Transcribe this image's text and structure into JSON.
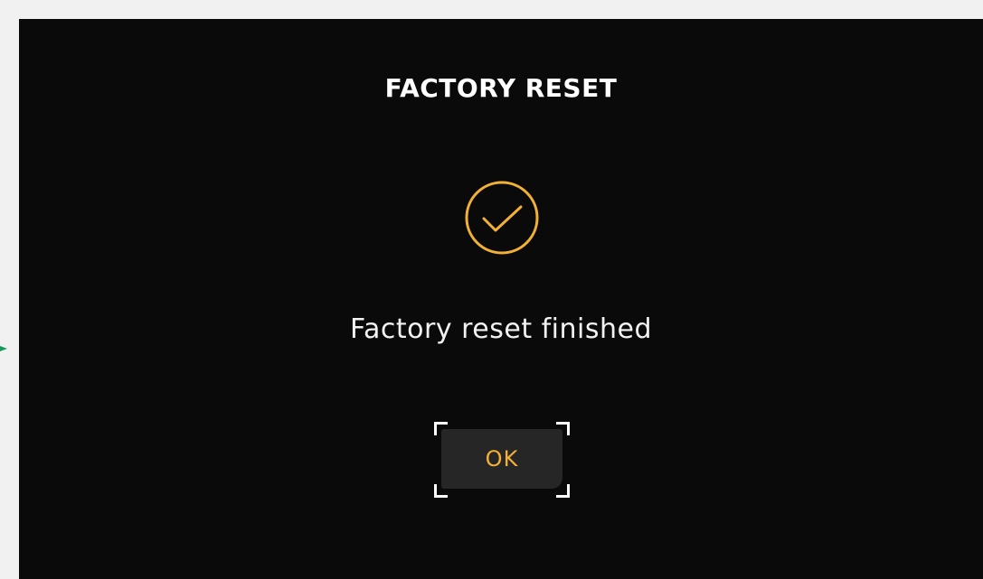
{
  "dialog": {
    "title": "FACTORY RESET",
    "message": "Factory reset finished",
    "ok_label": "OK"
  },
  "icons": {
    "status": "check-circle-icon",
    "side_marker": "arrow-right-icon"
  },
  "colors": {
    "background": "#0a0a0a",
    "outer_frame": "#f1f1f1",
    "accent": "#f2b135",
    "button_bg": "#262626",
    "focus_bracket": "#ffffff",
    "side_marker": "#1a9a5a"
  }
}
